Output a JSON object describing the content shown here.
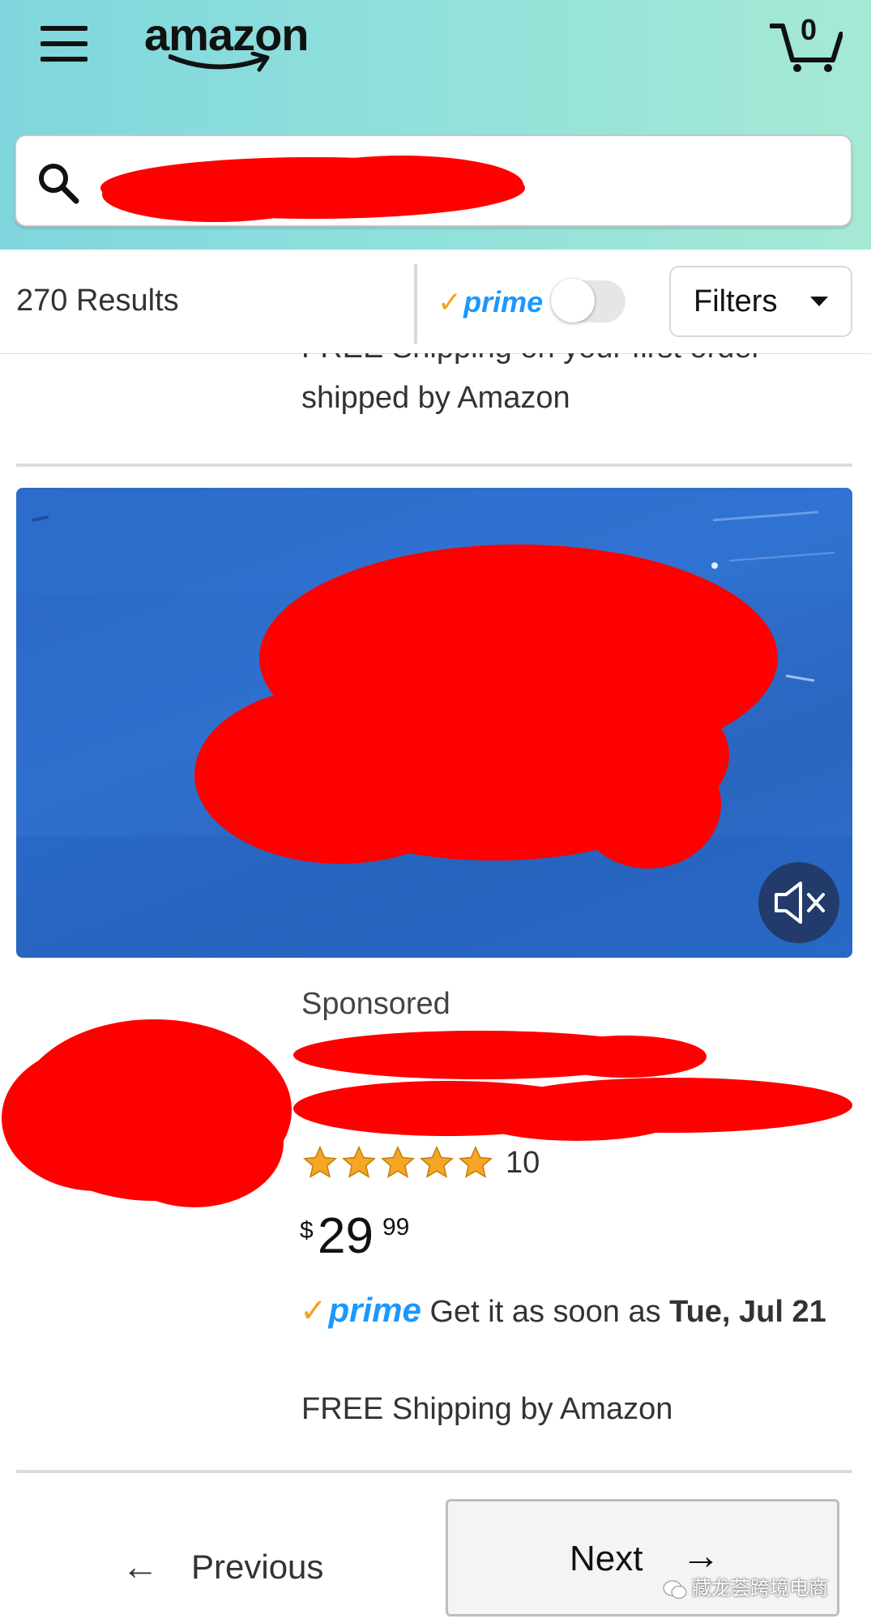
{
  "header": {
    "logo_text": "amazon",
    "cart_count": "0"
  },
  "search": {
    "value": "",
    "redacted": true
  },
  "results_bar": {
    "count_label": "270 Results",
    "prime_label": "prime",
    "prime_toggle_on": false,
    "filters_label": "Filters"
  },
  "previous_item": {
    "line1": "FREE Shipping on your first order",
    "line2": "shipped by Amazon"
  },
  "video": {
    "muted": true,
    "mute_icon": "speaker-muted-icon"
  },
  "product": {
    "sponsored_label": "Sponsored",
    "rating_stars": 5,
    "rating_count": "10",
    "price_symbol": "$",
    "price_whole": "29",
    "price_fraction": "99",
    "prime_label": "prime",
    "delivery_prefix": "Get it as soon as",
    "delivery_date": "Tue, Jul 21",
    "shipping": "FREE Shipping by Amazon"
  },
  "pagination": {
    "previous_label": "Previous",
    "next_label": "Next"
  },
  "watermark": {
    "text": "藏龙荟跨境电商"
  },
  "colors": {
    "header_gradient_start": "#7fd6dc",
    "header_gradient_end": "#a6e9d5",
    "prime_blue": "#1a98ff",
    "prime_check_orange": "#f7a21b",
    "star_gold": "#f5a623",
    "redaction_red": "#ff0000",
    "video_blue": "#2a66c0"
  }
}
